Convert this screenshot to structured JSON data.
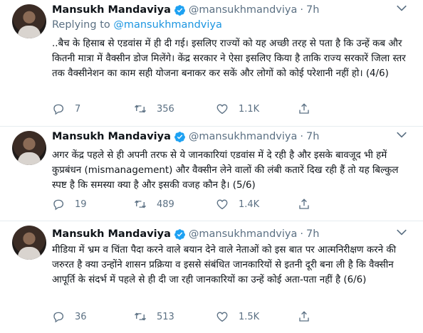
{
  "tweets": [
    {
      "name": "Mansukh Mandaviya",
      "handle": "@mansukhmandviya",
      "separator": "·",
      "time": "7h",
      "reply_prefix": "Replying to",
      "reply_to": "@mansukhmandviya",
      "text": "..बैच के हिसाब से एडवांस में ही दी गई। इसलिए राज्यों को यह अच्छी तरह से पता है कि उन्हें कब और कितनी मात्रा में वैक्सीन डोज मिलेंगे। केंद्र सरकार ने ऐसा इसलिए किया है ताकि राज्य सरकारें जिला स्तर तक वैक्सीनेशन का काम सही योजना बनाकर कर सकें और लोगों को कोई परेशानी नहीं हो। (4/6)",
      "replies": "7",
      "retweets": "356",
      "likes": "1.1K"
    },
    {
      "name": "Mansukh Mandaviya",
      "handle": "@mansukhmandviya",
      "separator": "·",
      "time": "7h",
      "text": "अगर केंद्र पहले से ही अपनी तरफ से ये जानकारियां एडवांस में दे रही है और इसके बावजूद भी हमें कुप्रबंधन (mismanagement) और वैक्सीन लेने वालों की लंबी कतारें दिख रही हैं तो यह बिल्कुल स्पष्ट है कि समस्या क्या है और इसकी वजह कौन है। (5/6)",
      "replies": "19",
      "retweets": "489",
      "likes": "1.4K"
    },
    {
      "name": "Mansukh Mandaviya",
      "handle": "@mansukhmandviya",
      "separator": "·",
      "time": "7h",
      "text": "मीडिया में भ्रम व चिंता पैदा करने वाले बयान देने वाले नेताओं को इस बात पर आत्मनिरीक्षण करने की जरुरत है क्या उन्होंने शासन प्रक्रिया व इससे संबंधित जानकारियों से इतनी दूरी बना ली है कि वैक्सीन आपूर्ति के संदर्भ में पहले से ही दी जा रही जानकारियों का उन्हें कोई अता-पता नहीं है (6/6)",
      "replies": "36",
      "retweets": "513",
      "likes": "1.5K"
    }
  ],
  "icons": {
    "verified": "verified-badge-icon",
    "more": "more-options-icon",
    "reply": "reply-icon",
    "retweet": "retweet-icon",
    "like": "heart-icon",
    "share": "share-icon"
  },
  "colors": {
    "verified_blue": "#1da1f2",
    "link_blue": "#1b95e0",
    "secondary_text": "#5b7083",
    "divider": "#e6ecf0"
  }
}
